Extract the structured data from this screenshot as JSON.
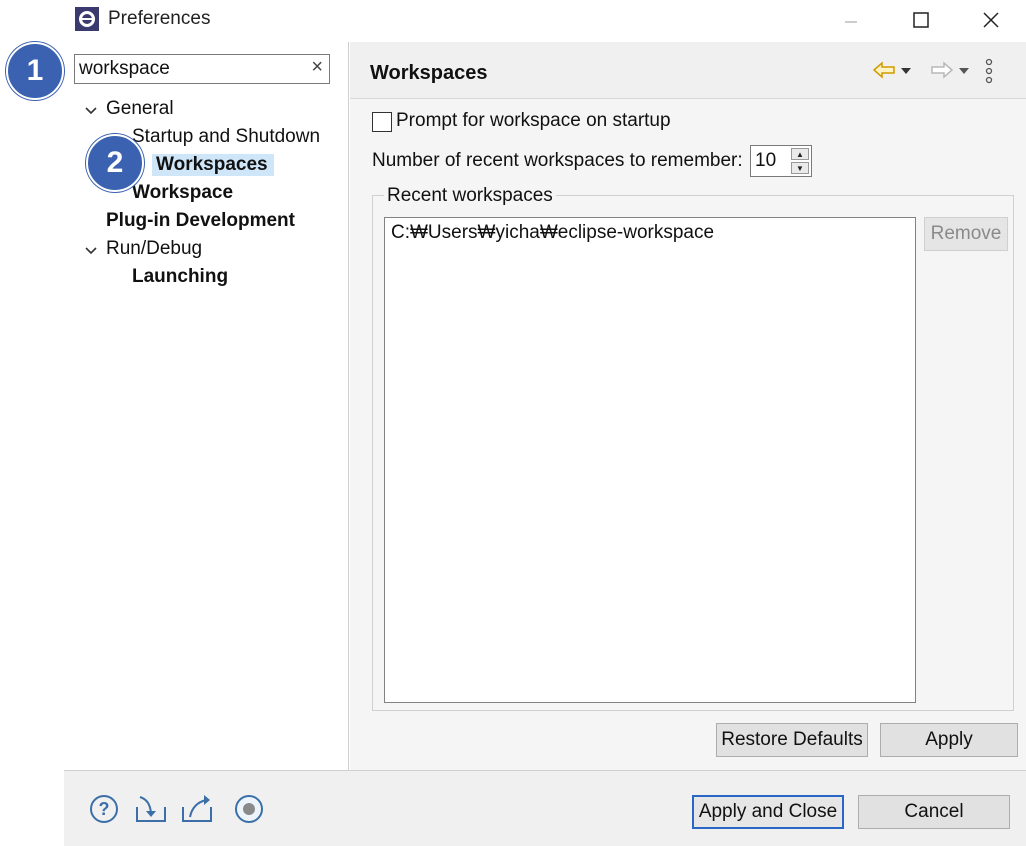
{
  "window": {
    "title": "Preferences"
  },
  "filter": {
    "value": "workspace",
    "clear_glyph": "×"
  },
  "tree": {
    "general": "General",
    "startup": "Startup and Shutdown",
    "workspaces": "Workspaces",
    "workspace": "Workspace",
    "plugin": "Plug-in Development",
    "rundebug": "Run/Debug",
    "launching": "Launching"
  },
  "badges": [
    "1",
    "2"
  ],
  "page": {
    "title": "Workspaces",
    "prompt_label": "Prompt for workspace on startup",
    "recent_label": "Number of recent workspaces to remember:",
    "recent_value": "10",
    "group_label": "Recent workspaces",
    "recent_items": [
      "C:₩Users₩yicha₩eclipse-workspace"
    ],
    "remove_label": "Remove",
    "restore_label": "Restore Defaults",
    "apply_label": "Apply"
  },
  "footer": {
    "apply_close_label": "Apply and Close",
    "cancel_label": "Cancel"
  },
  "colors": {
    "badge": "#3b62b0",
    "selection": "#cfe6f8",
    "accent": "#2a66c5",
    "nav_back": "#d19a00"
  }
}
